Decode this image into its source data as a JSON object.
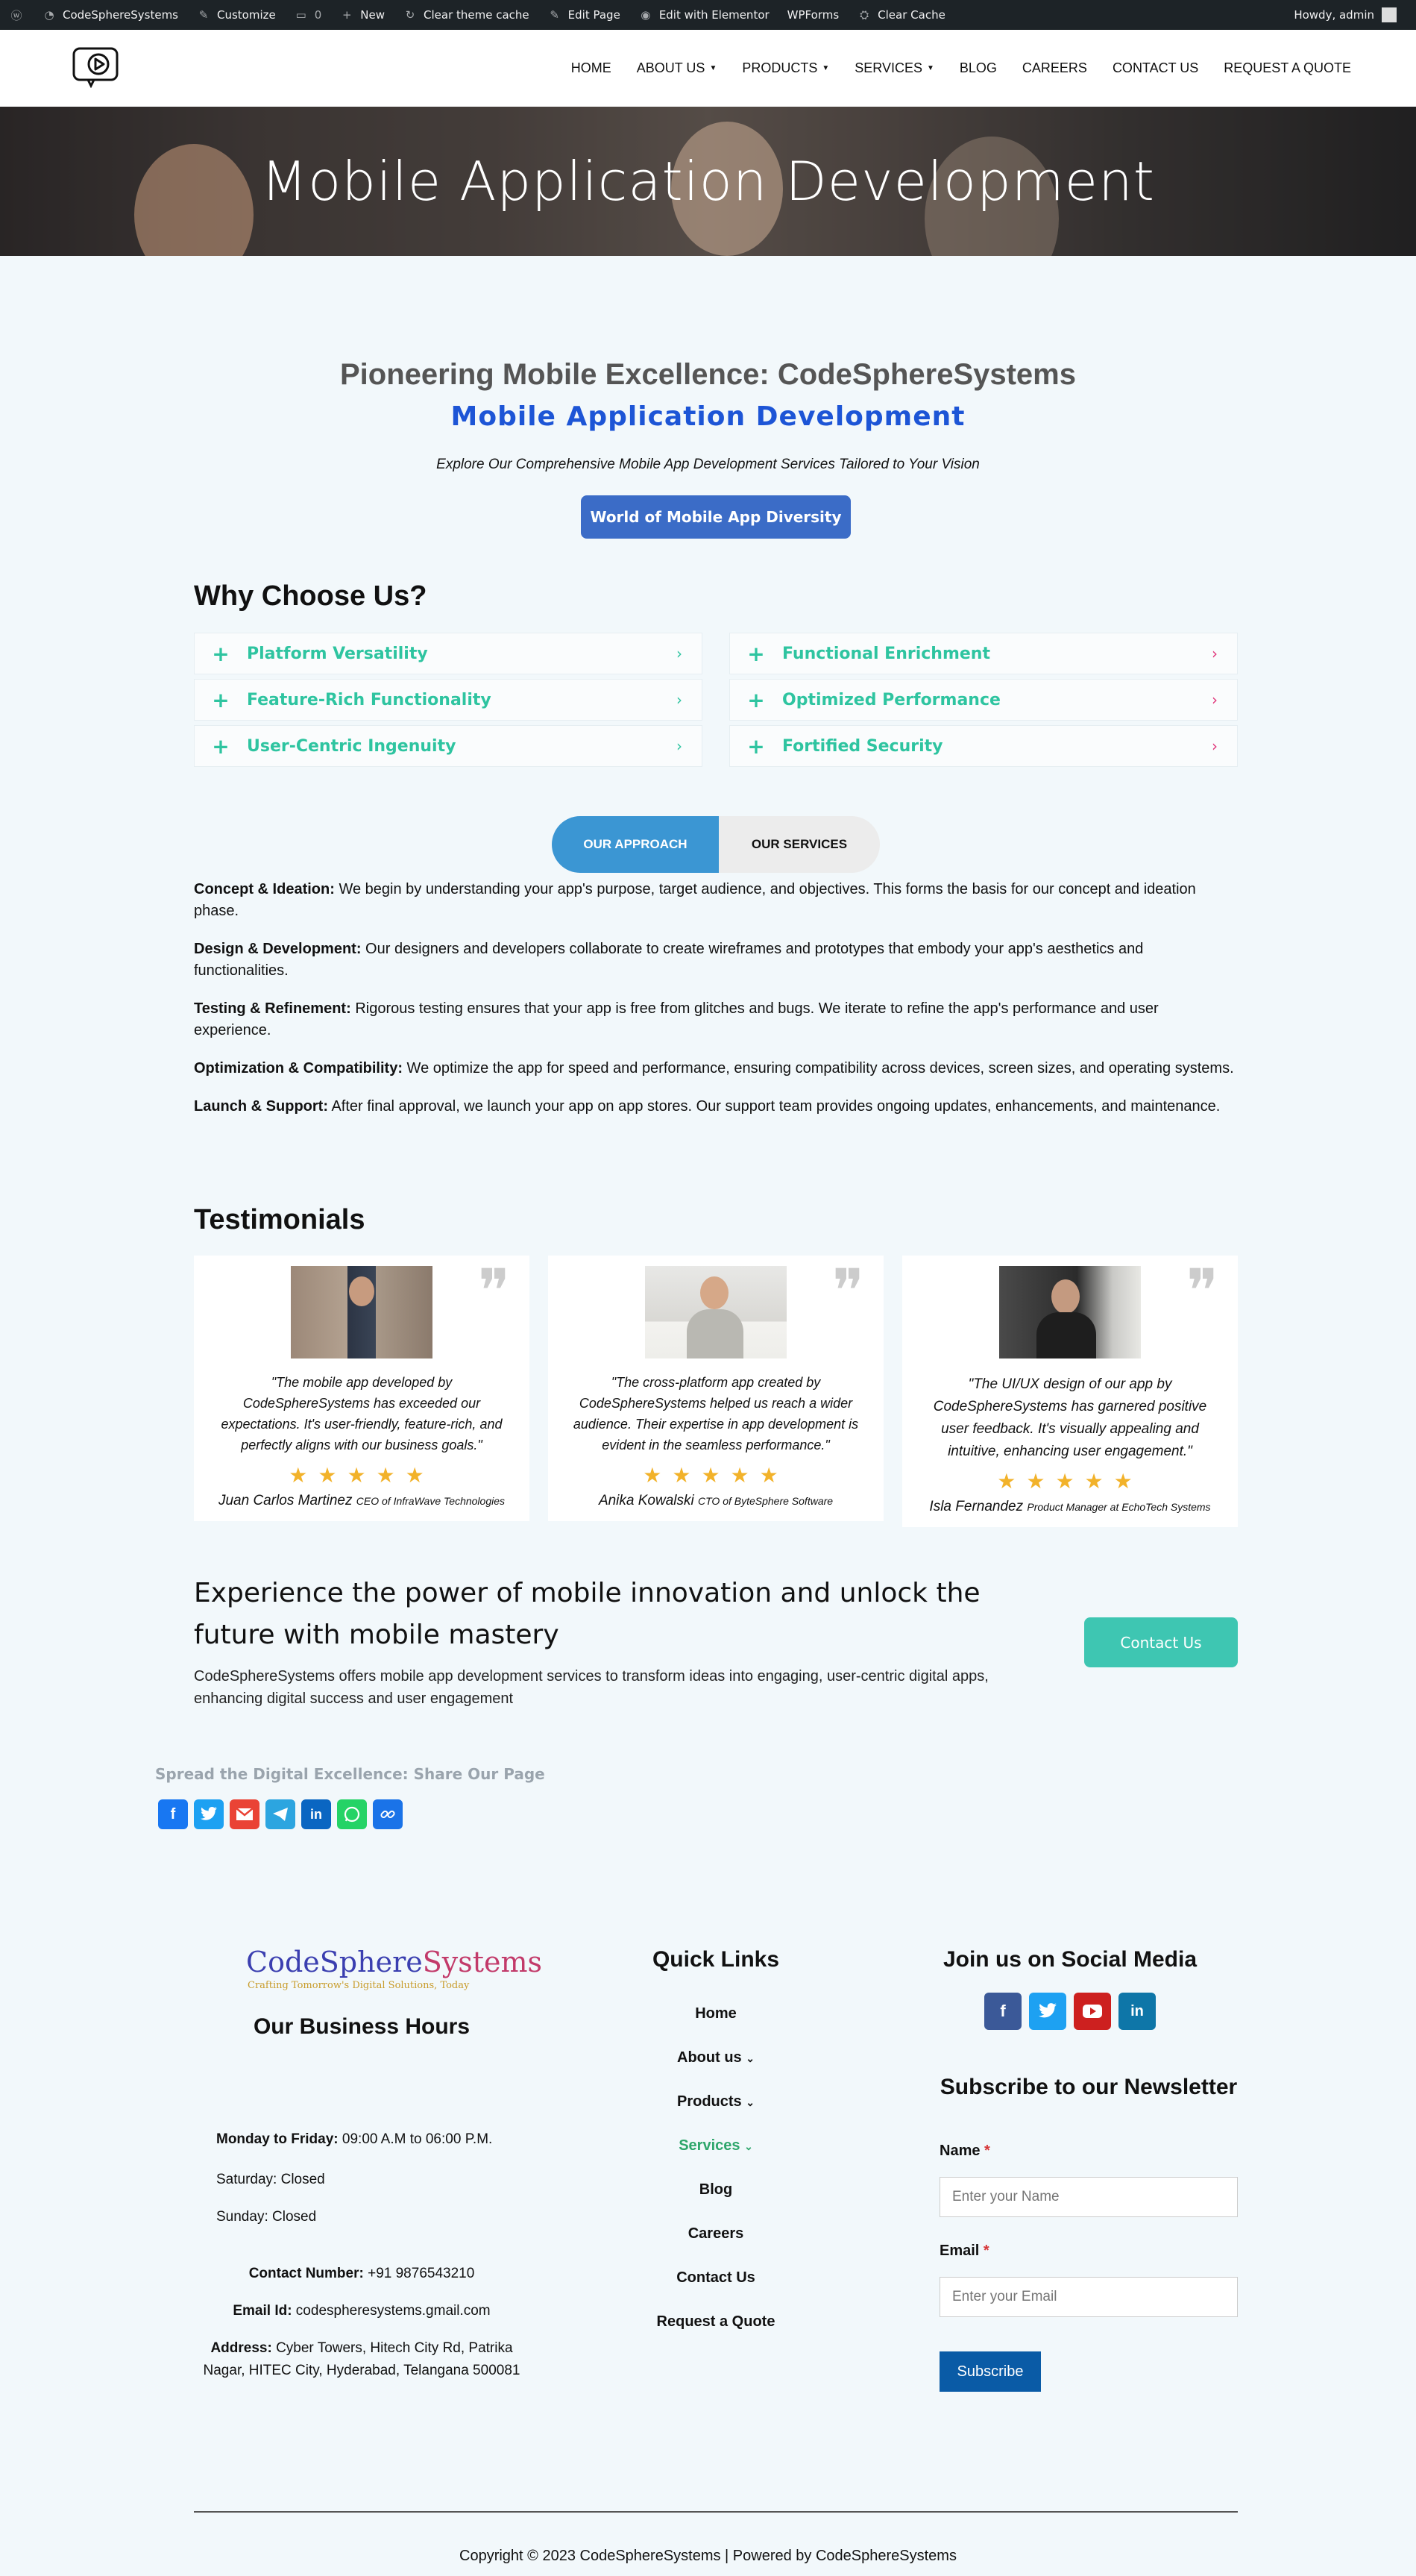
{
  "adminbar": {
    "site": "CodeSphereSystems",
    "customize": "Customize",
    "comments": "0",
    "new": "New",
    "clear_theme": "Clear theme cache",
    "edit_page": "Edit Page",
    "elementor": "Edit with Elementor",
    "wpforms": "WPForms",
    "clear_cache": "Clear Cache",
    "howdy": "Howdy, admin"
  },
  "nav": [
    "HOME",
    "ABOUT US",
    "PRODUCTS",
    "SERVICES",
    "BLOG",
    "CAREERS",
    "CONTACT US",
    "REQUEST A QUOTE"
  ],
  "hero": {
    "title": "Mobile Application Development"
  },
  "intro": {
    "heading": "Pioneering Mobile Excellence: CodeSphereSystems",
    "subheading": "Mobile Application Development",
    "tagline": "Explore Our Comprehensive Mobile App Development Services Tailored to Your Vision",
    "button": "World of Mobile App Diversity"
  },
  "why": {
    "title": "Why Choose Us?",
    "items": [
      "Platform Versatility",
      "Functional Enrichment",
      "Feature-Rich Functionality",
      "Optimized Performance",
      "User-Centric Ingenuity",
      "Fortified Security"
    ]
  },
  "tabs": {
    "approach": "OUR APPROACH",
    "services": "OUR SERVICES"
  },
  "approach": [
    {
      "title": "Concept & Ideation:",
      "text": " We begin by understanding your app's purpose, target audience, and objectives. This forms the basis for our concept and ideation phase."
    },
    {
      "title": "Design & Development:",
      "text": " Our designers and developers collaborate to create wireframes and prototypes that embody your app's aesthetics and functionalities."
    },
    {
      "title": "Testing & Refinement:",
      "text": " Rigorous testing ensures that your app is free from glitches and bugs. We iterate to refine the app's performance and user experience."
    },
    {
      "title": "Optimization & Compatibility:",
      "text": " We optimize the app for speed and performance, ensuring compatibility across devices, screen sizes, and operating systems."
    },
    {
      "title": "Launch & Support:",
      "text": " After final approval, we launch your app on app stores. Our support team provides ongoing updates, enhancements, and maintenance."
    }
  ],
  "testimonials": {
    "title": "Testimonials",
    "items": [
      {
        "quote": "\"The mobile app developed by CodeSphereSystems has exceeded our expectations. It's user-friendly, feature-rich, and perfectly aligns with our business goals.\"",
        "name": "Juan Carlos Martinez",
        "role": "CEO of InfraWave Technologies",
        "stars": 5
      },
      {
        "quote": "\"The cross-platform app created by CodeSphereSystems helped us reach a wider audience. Their expertise in app development is evident in the seamless performance.\"",
        "name": "Anika Kowalski",
        "role": "CTO of ByteSphere Software",
        "stars": 5
      },
      {
        "quote": "\"The UI/UX design of our app by CodeSphereSystems has garnered positive user feedback. It's visually appealing and intuitive, enhancing user engagement.\"",
        "name": "Isla Fernandez",
        "role": "Product Manager at EchoTech Systems",
        "stars": 5
      }
    ]
  },
  "cta": {
    "heading": "Experience the power of mobile innovation and unlock the future with mobile mastery",
    "text": "CodeSphereSystems offers mobile app development services to transform ideas into engaging, user-centric digital apps, enhancing digital success and user engagement",
    "button": "Contact Us"
  },
  "share": {
    "title": "Spread the Digital Excellence: Share Our Page"
  },
  "footer": {
    "brand_a": "CodeSphere",
    "brand_b": "Systems",
    "brand_tag": "Crafting Tomorrow's Digital Solutions, Today",
    "hours_title": "Our Business Hours",
    "weekday_label": "Monday to Friday:",
    "weekday_value": " 09:00 A.M to 06:00 P.M.",
    "saturday": "Saturday: Closed",
    "sunday": "Sunday: Closed",
    "contact_label": "Contact Number:",
    "contact_value": " +91 9876543210",
    "email_label": "Email Id:",
    "email_value": " codespheresystems.gmail.com",
    "address_label": "Address:",
    "address_value": " Cyber Towers, Hitech City Rd, Patrika Nagar, HITEC City, Hyderabad, Telangana 500081",
    "quick_title": "Quick Links",
    "quick_links": [
      "Home",
      "About us",
      "Products",
      "Services",
      "Blog",
      "Careers",
      "Contact Us",
      "Request a Quote"
    ],
    "social_title": "Join us on Social Media",
    "newsletter_title": "Subscribe to our Newsletter",
    "name_label": "Name",
    "name_placeholder": "Enter your Name",
    "email_label2": "Email",
    "email_placeholder": "Enter your Email",
    "subscribe": "Subscribe",
    "copyright": "Copyright © 2023 CodeSphereSystems | Powered by CodeSphereSystems"
  },
  "colors": {
    "accent": "#2ec4a0",
    "primary": "#3b6cc7",
    "tab": "#3b96d3",
    "cta": "#3ec6b2",
    "closed": "#e0473c"
  }
}
